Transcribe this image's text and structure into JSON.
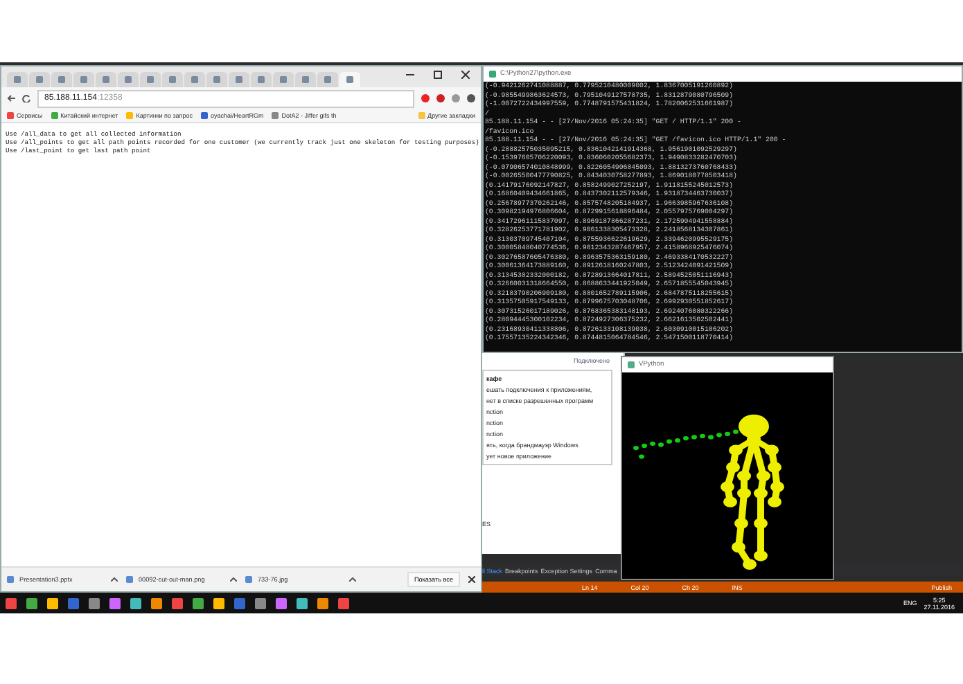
{
  "browser": {
    "tabs": [
      {
        "selected": false
      },
      {
        "selected": false
      },
      {
        "selected": false
      },
      {
        "selected": false
      },
      {
        "selected": false
      },
      {
        "selected": false
      },
      {
        "selected": false
      },
      {
        "selected": false
      },
      {
        "selected": false
      },
      {
        "selected": false
      },
      {
        "selected": false
      },
      {
        "selected": false
      },
      {
        "selected": false
      },
      {
        "selected": false
      },
      {
        "selected": false
      },
      {
        "selected": true
      }
    ],
    "address": {
      "host": "85.188.11.154",
      "port": ":12358"
    },
    "bookmarks": [
      {
        "label": "Сервисы"
      },
      {
        "label": "Китайский интернет"
      },
      {
        "label": "Картинки по запрос"
      },
      {
        "label": "oyachai/HeartRGm"
      },
      {
        "label": "DotA2 - Jiffer gifs th"
      }
    ],
    "other_bookmarks": "Другие закладки",
    "content": [
      "Use /all_data to get all collected information",
      "Use /all_points to get all path points recorded for one customer (we currently track just one skeleton for testing purposes)",
      "Use /last_point to get last path point"
    ],
    "downloads": [
      {
        "name": "Presentation3.pptx"
      },
      {
        "name": "00092-cut-out-man.png"
      },
      {
        "name": "733-76.jpg"
      }
    ],
    "show_all": "Показать все"
  },
  "console": {
    "title": "C:\\Python27\\python.exe",
    "lines": [
      "(-0.9421262741088887, 0.7795210480009002, 1.8367005191260892)",
      "(-0.9855499863624573, 0.7951049127578735, 1.8312879080796509)",
      "(-1.0072722434997559, 0.7748791575431824, 1.7820062531661987)",
      "/",
      "85.188.11.154 - - [27/Nov/2016 05:24:35] \"GET / HTTP/1.1\" 200 -",
      "/favicon.ico",
      "85.188.11.154 - - [27/Nov/2016 05:24:35] \"GET /favicon.ico HTTP/1.1\" 200 -",
      "(-0.28882575035095215, 0.8361042141914368, 1.9561901092529297)",
      "(-0.15397605706220093, 0.8360602055682373, 1.9490833282470703)",
      "(-0.07906574010848999, 0.8226054906845093, 1.8813273760768433)",
      "(-0.00265500477790825, 0.8434030758277893, 1.8690180778503418)",
      "(0.14179176092147827, 0.8582499027252197, 1.9118155245012573)",
      "(0.16860409434661865, 0.8437302112579346, 1.9318734463730037)",
      "(0.25678977370262146, 0.8575748205184937, 1.9663985967636108)",
      "(0.30982194976806604, 0.8729915618896484, 2.0557975769004297)",
      "(0.34172961115837097, 0.8969187866287231, 2.1725904941558884)",
      "(0.32826253771781902, 0.9061338305473328, 2.2418568134307861)",
      "(0.31303709745407104, 0.8755936622619629, 2.3394620995529175)",
      "(0.30005848040774536, 0.9012343287467957, 2.4158968925476074)",
      "(0.30276587605476380, 0.8963575363159180, 2.4693384170532227)",
      "(0.30061364173889160, 0.8912618160247803, 2.5123424091421509)",
      "(0.31345382332000182, 0.8728913664017811, 2.5894525051116943)",
      "(0.32660031318664550, 0.8688633441925049, 2.6571855545043945)",
      "(0.32183790206909180, 0.8801652789115906, 2.6847875118255615)",
      "(0.31357505917549133, 0.8799675703048706, 2.6992930551852617)",
      "(0.30731526017189026, 0.8768365383148193, 2.6924076080322266)",
      "(0.28094445300102234, 0.8724927306375232, 2.6621613502502441)",
      "(0.23168930411338806, 0.8726133108139038, 2.6030910015106202)",
      "(0.17557135224342346, 0.8744815064784546, 2.5471500118770414)"
    ]
  },
  "firewall": {
    "status": "Подключено",
    "heading": "кафе",
    "lines": [
      "ешать подключения к приложениям,",
      "нет в списке разрешенных программ",
      "nction",
      "nction",
      "nction",
      "ять, когда брандмауэр Windows",
      "ует новое приложение"
    ],
    "footer": "ES"
  },
  "vpython": {
    "title": "VPython"
  },
  "ide": {
    "tabs": [
      {
        "label": "ll Stack",
        "selected": true
      },
      {
        "label": "Breakpoints",
        "selected": false
      },
      {
        "label": "Exception Settings",
        "selected": false
      },
      {
        "label": "Comma",
        "selected": false
      }
    ],
    "status": [
      "Ln 14",
      "Col 20",
      "Ch 20",
      "INS"
    ],
    "publish": "Publish"
  },
  "taskbar": {
    "language": "ENG",
    "time": "5:25",
    "date": "27.11.2016"
  }
}
